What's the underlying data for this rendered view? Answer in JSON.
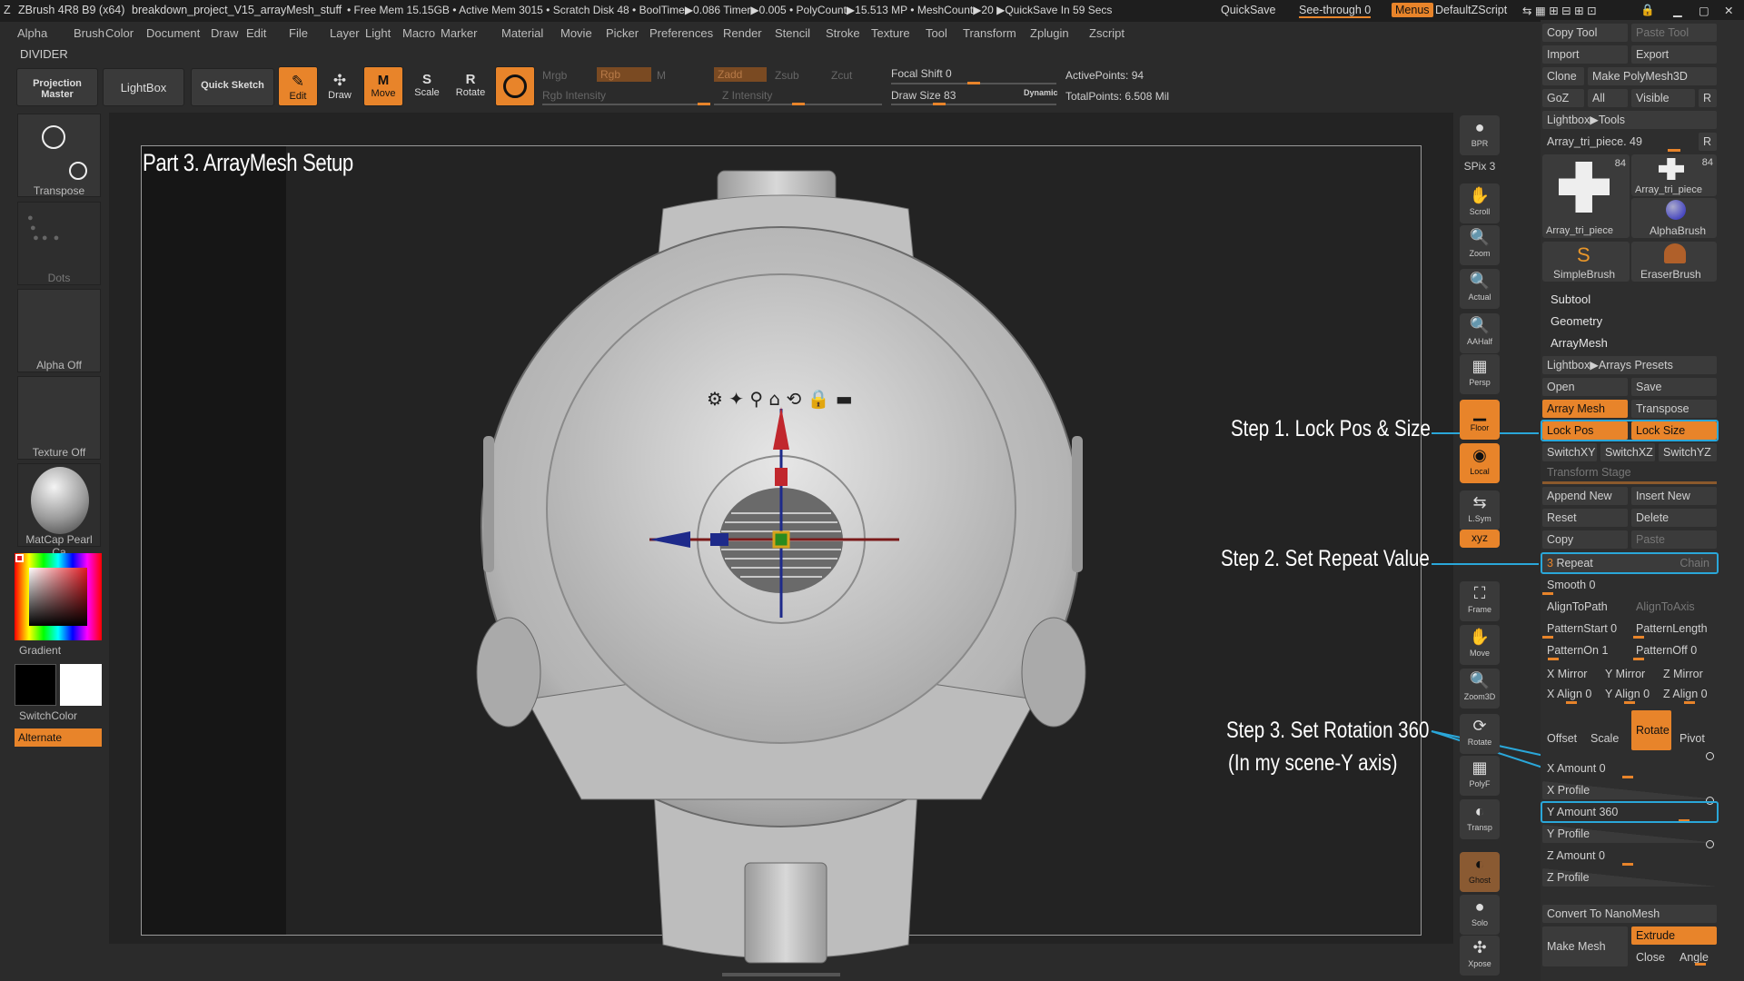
{
  "titlebar": {
    "app": "ZBrush 4R8 B9 (x64)",
    "file": "breakdown_project_V15_arrayMesh_stuff",
    "stats": "• Free Mem 15.15GB • Active Mem 3015 • Scratch Disk 48 • BoolTime▶0.086 Timer▶0.005 • PolyCount▶15.513 MP • MeshCount▶20 ▶QuickSave In 59 Secs",
    "quicksave": "QuickSave",
    "seethrough": "See-through  0",
    "menus": "Menus",
    "script": "DefaultZScript"
  },
  "menus": [
    "Alpha",
    "Brush",
    "Color",
    "Document",
    "Draw",
    "Edit",
    "File",
    "Layer",
    "Light",
    "Macro",
    "Marker",
    "Material",
    "Movie",
    "Picker",
    "Preferences",
    "Render",
    "Stencil",
    "Stroke",
    "Texture",
    "Tool",
    "Transform",
    "Zplugin",
    "Zscript"
  ],
  "divider_label": "DIVIDER",
  "toolbar": {
    "projection_master": "Projection Master",
    "lightbox": "LightBox",
    "quick_sketch": "Quick Sketch",
    "edit": "Edit",
    "draw": "Draw",
    "move": "Move",
    "scale": "Scale",
    "rotate": "Rotate",
    "mrgb": "Mrgb",
    "rgb": "Rgb",
    "m": "M",
    "rgb_intensity": "Rgb Intensity",
    "zadd": "Zadd",
    "zsub": "Zsub",
    "zcut": "Zcut",
    "z_intensity": "Z Intensity",
    "focal_shift": "Focal Shift 0",
    "draw_size": "Draw Size 83",
    "dynamic": "Dynamic",
    "active_points": "ActivePoints: 94",
    "total_points": "TotalPoints: 6.508 Mil"
  },
  "left": {
    "transpose": "Transpose",
    "dots": "Dots",
    "alpha": "Alpha Off",
    "texture": "Texture Off",
    "material": "MatCap Pearl Ca",
    "gradient": "Gradient",
    "switchcolor": "SwitchColor",
    "alternate": "Alternate"
  },
  "canvas": {
    "part_title": "Part 3. ArrayMesh Setup",
    "step1": "Step 1. Lock Pos & Size",
    "step2": "Step 2. Set Repeat Value",
    "step3a": "Step 3. Set Rotation 360",
    "step3b": "(In my scene-Y axis)"
  },
  "right_tools": [
    {
      "name": "bpr",
      "label": "BPR",
      "glyph": "●"
    },
    {
      "name": "spix",
      "label": "SPix 3",
      "glyph": ""
    },
    {
      "name": "scroll",
      "label": "Scroll",
      "glyph": "✋"
    },
    {
      "name": "zoom",
      "label": "Zoom",
      "glyph": "🔍"
    },
    {
      "name": "actual",
      "label": "Actual",
      "glyph": "🔍"
    },
    {
      "name": "aahalf",
      "label": "AAHalf",
      "glyph": "🔍"
    },
    {
      "name": "persp",
      "label": "Persp",
      "glyph": "▦"
    },
    {
      "name": "floor",
      "label": "Floor",
      "glyph": "▁"
    },
    {
      "name": "local",
      "label": "Local",
      "glyph": "◉"
    },
    {
      "name": "lsym",
      "label": "L.Sym",
      "glyph": "⇆"
    },
    {
      "name": "xyz",
      "label": "xyz",
      "glyph": ""
    },
    {
      "name": "frame",
      "label": "Frame",
      "glyph": "⛶"
    },
    {
      "name": "move",
      "label": "Move",
      "glyph": "✋"
    },
    {
      "name": "zoom3d",
      "label": "Zoom3D",
      "glyph": "🔍"
    },
    {
      "name": "rotate",
      "label": "Rotate",
      "glyph": "⟳"
    },
    {
      "name": "polyf",
      "label": "PolyF",
      "glyph": "▦"
    },
    {
      "name": "transp",
      "label": "Transp",
      "glyph": "◐"
    },
    {
      "name": "ghost",
      "label": "Ghost",
      "glyph": "◐"
    },
    {
      "name": "solo",
      "label": "Solo",
      "glyph": "●"
    },
    {
      "name": "xpose",
      "label": "Xpose",
      "glyph": "✣"
    }
  ],
  "panel": {
    "copy_tool": "Copy Tool",
    "paste_tool": "Paste Tool",
    "import": "Import",
    "export": "Export",
    "clone": "Clone",
    "make_polymesh": "Make PolyMesh3D",
    "goz": "GoZ",
    "all": "All",
    "visible": "Visible",
    "r": "R",
    "lightbox_tools": "Lightbox▶Tools",
    "array_piece": "Array_tri_piece. 49",
    "thumb1": "Array_tri_piece",
    "thumb1_count": "84",
    "thumb2": "Array_tri_piece",
    "thumb2_count": "84",
    "alphabrush": "AlphaBrush",
    "simplebrush": "SimpleBrush",
    "eraserbrush": "EraserBrush",
    "subtool": "Subtool",
    "geometry": "Geometry",
    "arraymesh": "ArrayMesh",
    "arrays_presets": "Lightbox▶Arrays Presets",
    "open": "Open",
    "save": "Save",
    "array_mesh": "Array Mesh",
    "transpose": "Transpose",
    "lock_pos": "Lock Pos",
    "lock_size": "Lock Size",
    "switchxy": "SwitchXY",
    "switchxz": "SwitchXZ",
    "switchyz": "SwitchYZ",
    "transform_stage": "Transform Stage",
    "append_new": "Append New",
    "insert_new": "Insert New",
    "reset": "Reset",
    "delete": "Delete",
    "copy": "Copy",
    "paste": "Paste",
    "repeat_value": "3",
    "repeat": "Repeat",
    "chain": "Chain",
    "smooth": "Smooth 0",
    "align_to_path": "AlignToPath",
    "align_to_axis": "AlignToAxis",
    "pattern_start": "PatternStart 0",
    "pattern_length": "PatternLength",
    "pattern_on": "PatternOn 1",
    "pattern_off": "PatternOff 0",
    "x_mirror": "X Mirror",
    "y_mirror": "Y Mirror",
    "z_mirror": "Z Mirror",
    "x_align": "X Align 0",
    "y_align": "Y Align 0",
    "z_align": "Z Align 0",
    "offset": "Offset",
    "scale": "Scale",
    "rotate": "Rotate",
    "pivot": "Pivot",
    "x_amount": "X Amount 0",
    "x_profile": "X Profile",
    "y_amount": "Y Amount 360",
    "y_profile": "Y Profile",
    "z_amount": "Z Amount 0",
    "z_profile": "Z Profile",
    "convert_nanomesh": "Convert To NanoMesh",
    "make_mesh": "Make Mesh",
    "extrude": "Extrude",
    "close": "Close",
    "angle": "Angle"
  }
}
